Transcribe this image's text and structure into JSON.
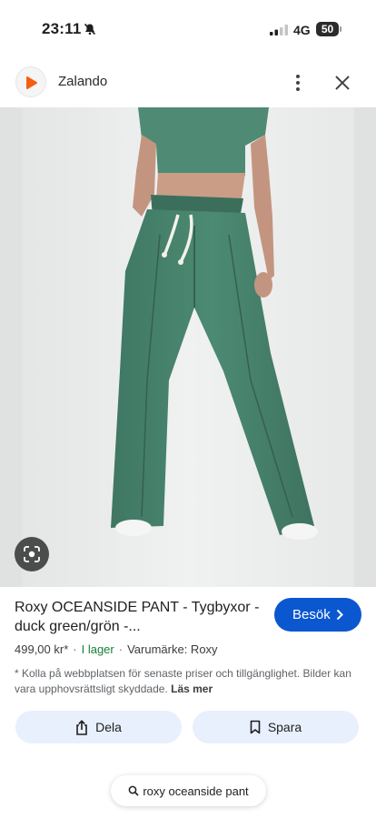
{
  "status_bar": {
    "time": "23:11",
    "network": "4G",
    "battery": "50"
  },
  "source": {
    "site_name": "Zalando",
    "brand_color": "#f45e13"
  },
  "image": {
    "subject": "woman wearing green drawstring wide-leg pants with white sneakers"
  },
  "product": {
    "title": "Roxy OCEANSIDE PANT - Tygbyxor - duck green/grön -...",
    "price": "499,00 kr*",
    "stock": "I lager",
    "brand": "Varumärke: Roxy",
    "disclaimer": "* Kolla på webbplatsen för senaste priser och tillgänglighet. Bilder kan vara upphovsrättsligt skyddade.",
    "read_more": "Läs mer"
  },
  "actions": {
    "visit": "Besök",
    "share": "Dela",
    "save": "Spara"
  },
  "search": {
    "query": "roxy oceanside pant"
  },
  "colors": {
    "accent": "#0b57d0",
    "in_stock": "#188038",
    "chip_bg": "#e8f0fe"
  }
}
